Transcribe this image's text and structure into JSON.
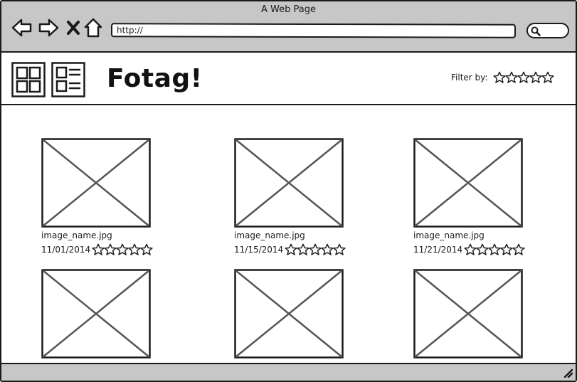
{
  "browser": {
    "title": "A Web Page",
    "url": "http://",
    "back_icon": "back-arrow-icon",
    "forward_icon": "forward-arrow-icon",
    "stop_icon": "close-icon",
    "home_icon": "home-icon",
    "search_icon": "search-icon"
  },
  "app": {
    "title": "Fotag!",
    "grid_view_icon": "grid-view-icon",
    "list_view_icon": "list-view-icon",
    "filter_label": "Filter by:",
    "filter_rating": 0,
    "max_stars": 5
  },
  "images": [
    {
      "name": "image_name.jpg",
      "date": "11/01/2014",
      "rating": 0
    },
    {
      "name": "image_name.jpg",
      "date": "11/15/2014",
      "rating": 0
    },
    {
      "name": "image_name.jpg",
      "date": "11/21/2014",
      "rating": 0
    },
    {
      "name": "",
      "date": "",
      "rating": 0
    },
    {
      "name": "",
      "date": "",
      "rating": 0
    },
    {
      "name": "",
      "date": "",
      "rating": 0
    }
  ],
  "colors": {
    "chrome": "#c7c7c7",
    "ink": "#1a1a1a",
    "placeholder_line": "#555555"
  }
}
